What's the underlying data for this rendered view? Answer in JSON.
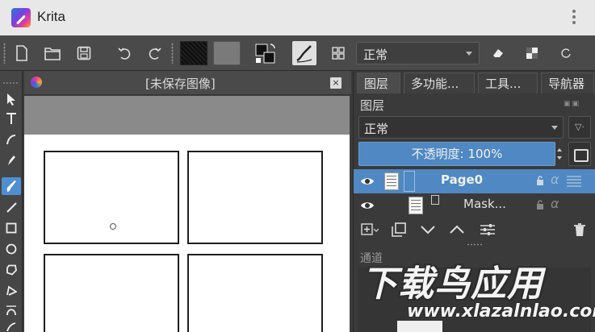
{
  "titlebar": {
    "app_name": "Krita"
  },
  "toolbar": {
    "blend_mode": "正常",
    "icons": [
      "new-document-icon",
      "open-folder-icon",
      "save-icon",
      "undo-icon",
      "redo-icon",
      "gradient-swatch",
      "pattern-swatch",
      "color-swap-icon",
      "brush-preset-icon",
      "workspace-grid-icon",
      "eraser-icon",
      "alpha-lock-icon",
      "reload-icon"
    ]
  },
  "document": {
    "title": "[未保存图像]",
    "close_glyph": "×"
  },
  "dock": {
    "tabs": [
      "图层",
      "多功能...",
      "工具...",
      "导航器"
    ],
    "layers_title": "图层",
    "blend_mode": "正常",
    "opacity_label": "不透明度: 100%",
    "layers": [
      {
        "name": "Page0",
        "selected": true
      },
      {
        "name": "Mask...",
        "selected": false
      }
    ],
    "channels_title": "通道"
  },
  "watermark": {
    "text": "下载鸟应用",
    "url": "www.xlazalnlao.com"
  },
  "colors": {
    "accent": "#4f88c2",
    "toolbox_selected": "#4f8fd1",
    "titlebar_bg": "#e8e8e8",
    "panel_bg": "#3a3a3a"
  }
}
